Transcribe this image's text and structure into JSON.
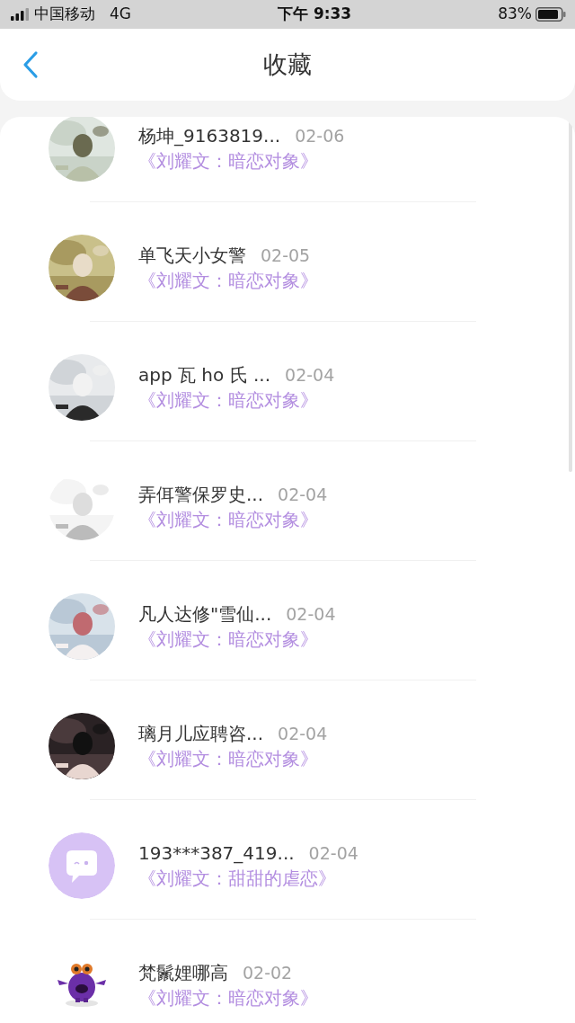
{
  "status_bar": {
    "carrier": "中国移动",
    "network": "4G",
    "time": "下午 9:33",
    "battery": "83%"
  },
  "header": {
    "title": "收藏"
  },
  "favorites": [
    {
      "name": "杨坤_9163819...",
      "date": "02-06",
      "work": "《刘耀文：暗恋对象》"
    },
    {
      "name": "单飞天小女警",
      "date": "02-05",
      "work": "《刘耀文：暗恋对象》"
    },
    {
      "name": "app 瓦 ho 氏 ...",
      "date": "02-04",
      "work": "《刘耀文：暗恋对象》"
    },
    {
      "name": "弄佴警保罗史...",
      "date": "02-04",
      "work": "《刘耀文：暗恋对象》"
    },
    {
      "name": "凡人达修\"雪仙...",
      "date": "02-04",
      "work": "《刘耀文：暗恋对象》"
    },
    {
      "name": "璃月儿应聘咨...",
      "date": "02-04",
      "work": "《刘耀文：暗恋对象》"
    },
    {
      "name": "193***387_419...",
      "date": "02-04",
      "work": "《刘耀文：甜甜的虐恋》",
      "avatar": {
        "kind": "default"
      }
    },
    {
      "name": "梵鬛娌哪高",
      "date": "02-02",
      "work": "《刘耀文：暗恋对象》",
      "avatar": {
        "kind": "mascot"
      }
    }
  ]
}
